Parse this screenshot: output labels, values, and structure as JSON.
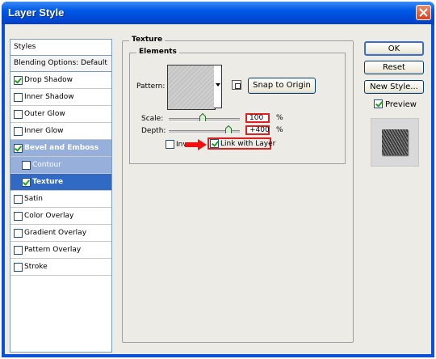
{
  "window": {
    "title": "Layer Style"
  },
  "styles_panel": {
    "header": "Styles",
    "blending": "Blending Options: Default",
    "items": [
      {
        "label": "Drop Shadow",
        "checked": true,
        "state": "normal"
      },
      {
        "label": "Inner Shadow",
        "checked": false,
        "state": "normal"
      },
      {
        "label": "Outer Glow",
        "checked": false,
        "state": "normal"
      },
      {
        "label": "Inner Glow",
        "checked": false,
        "state": "normal"
      },
      {
        "label": "Bevel and Emboss",
        "checked": true,
        "state": "parent-selected"
      },
      {
        "label": "Contour",
        "checked": false,
        "state": "sub"
      },
      {
        "label": "Texture",
        "checked": true,
        "state": "selected"
      },
      {
        "label": "Satin",
        "checked": false,
        "state": "normal"
      },
      {
        "label": "Color Overlay",
        "checked": false,
        "state": "normal"
      },
      {
        "label": "Gradient Overlay",
        "checked": false,
        "state": "normal"
      },
      {
        "label": "Pattern Overlay",
        "checked": false,
        "state": "normal"
      },
      {
        "label": "Stroke",
        "checked": false,
        "state": "normal"
      }
    ]
  },
  "texture": {
    "group_title": "Texture",
    "elements_title": "Elements",
    "pattern_label": "Pattern:",
    "snap_button": "Snap to Origin",
    "scale_label": "Scale:",
    "scale_value": "100",
    "scale_unit": "%",
    "scale_fraction": 0.48,
    "depth_label": "Depth:",
    "depth_value": "+400",
    "depth_unit": "%",
    "depth_fraction": 0.84,
    "invert_label": "Inv",
    "invert_checked": false,
    "link_label": "Link with Layer",
    "link_checked": true
  },
  "buttons": {
    "ok": "OK",
    "reset": "Reset",
    "new_style": "New Style...",
    "preview_label": "Preview",
    "preview_checked": true
  },
  "colors": {
    "highlight": "#e02020",
    "selection": "#316ac5",
    "title_bar": "#0058e6"
  }
}
